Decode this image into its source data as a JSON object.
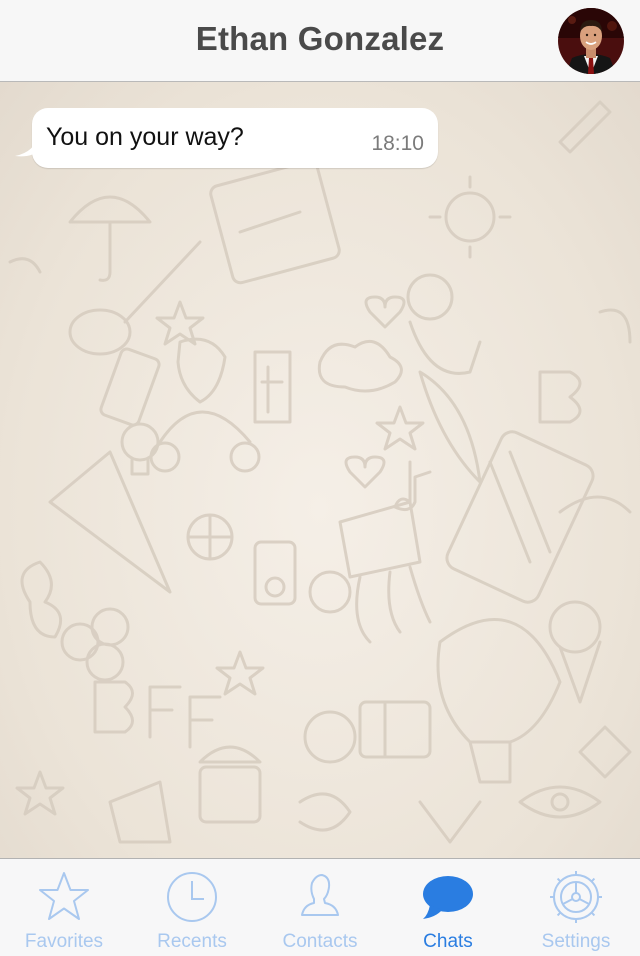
{
  "header": {
    "title": "Ethan Gonzalez",
    "avatar_icon": "contact-avatar"
  },
  "messages": [
    {
      "text": "You on your way?",
      "time": "18:10",
      "direction": "incoming"
    }
  ],
  "tabs": [
    {
      "label": "Favorites",
      "icon": "star-icon",
      "active": false
    },
    {
      "label": "Recents",
      "icon": "clock-icon",
      "active": false
    },
    {
      "label": "Contacts",
      "icon": "person-icon",
      "active": false
    },
    {
      "label": "Chats",
      "icon": "chat-bubble-icon",
      "active": true
    },
    {
      "label": "Settings",
      "icon": "gear-icon",
      "active": false
    }
  ],
  "colors": {
    "accent": "#2a7de1",
    "inactive_tab": "#a9c8ef",
    "chat_background": "#ece5dc",
    "bubble": "#ffffff"
  }
}
